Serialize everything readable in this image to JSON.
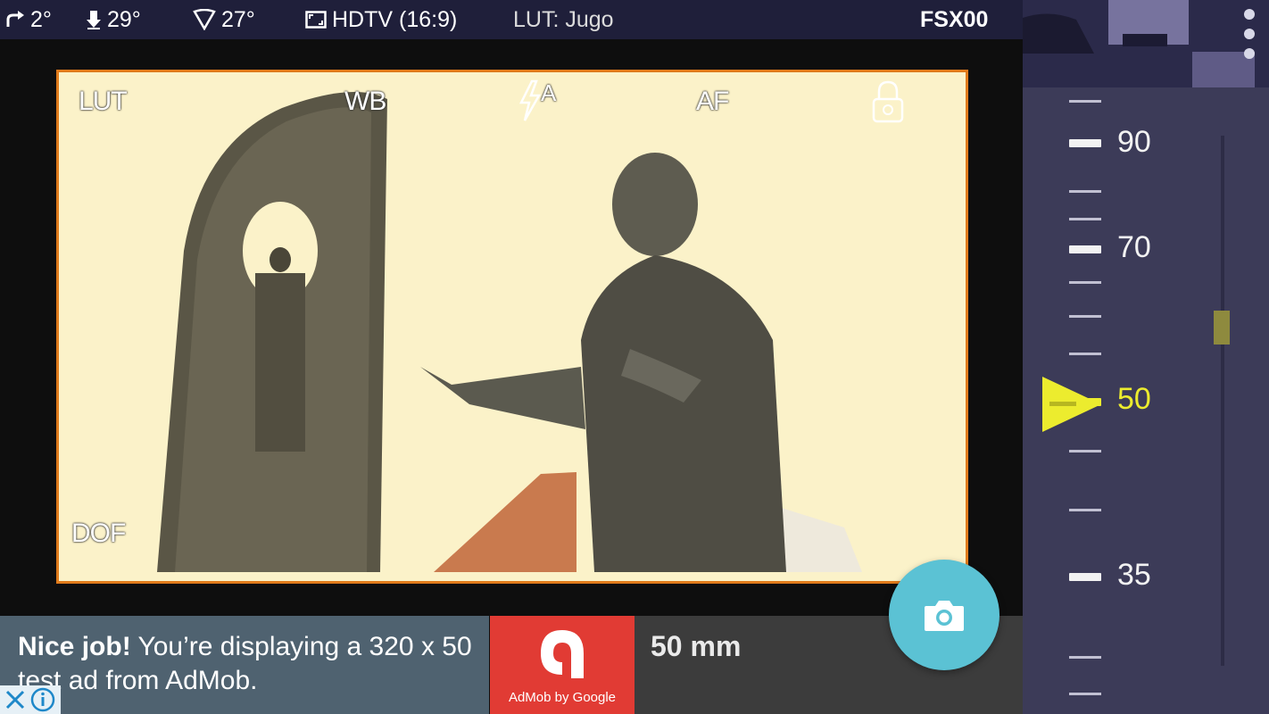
{
  "status": {
    "tilt": "2°",
    "pitch": "29°",
    "angle": "27°",
    "aspect": "HDTV (16:9)",
    "lut": "LUT: Jugo",
    "camera_id": "FSX00"
  },
  "overlay": {
    "lut": "LUT",
    "wb": "WB",
    "af": "AF",
    "dof": "DOF",
    "flash_mode": "A"
  },
  "zoom_dial": {
    "labels": [
      "90",
      "70",
      "50",
      "35"
    ],
    "active": "50"
  },
  "ad": {
    "bold": "Nice job!",
    "text": " You’re displaying a 320 x 50 test ad from AdMob.",
    "logo_caption": "AdMob by Google"
  },
  "focal_length": "50 mm",
  "colors": {
    "frame_border": "#e07b1b",
    "accent_yellow": "#ecec2e",
    "shutter": "#5bc2d4",
    "ad_red": "#e13b34"
  }
}
